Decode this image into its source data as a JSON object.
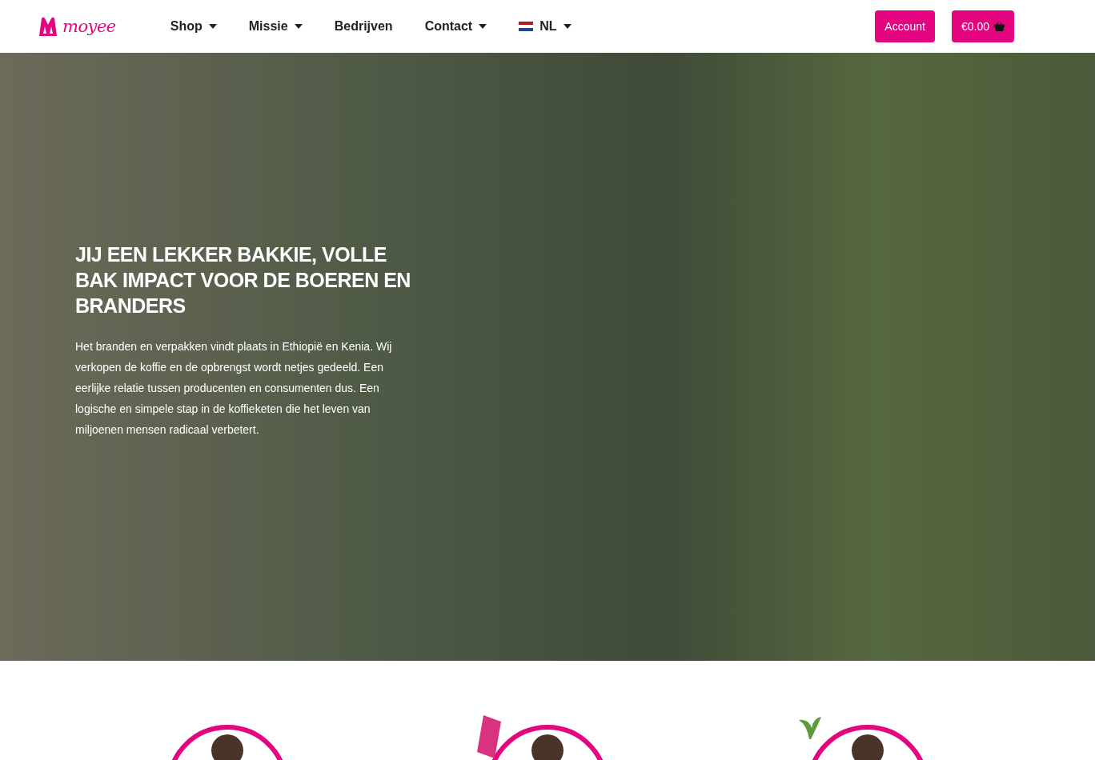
{
  "header": {
    "logo_text": "moyee",
    "nav": [
      {
        "label": "Shop",
        "dropdown": true,
        "kind": "text"
      },
      {
        "label": "Missie",
        "dropdown": true,
        "kind": "text"
      },
      {
        "label": "Bedrijven",
        "dropdown": false,
        "kind": "text"
      },
      {
        "label": "Contact",
        "dropdown": true,
        "kind": "text"
      },
      {
        "label": "NL",
        "dropdown": true,
        "kind": "language"
      }
    ],
    "account_button": "Account",
    "cart_button": "€0.00"
  },
  "hero": {
    "heading": "JIJ EEN LEKKER BAKKIE, VOLLE BAK IMPACT VOOR DE BOEREN EN BRANDERS",
    "text": "Het branden en verpakken vindt plaats in Ethiopië en Kenia. Wij verkopen de koffie en de opbrengst wordt netjes gedeeld. Een eerlijke relatie tussen producenten en consumenten dus. Een logische en simpele stap in de koffieketen die het leven van miljoenen mensen radicaal verbetert."
  },
  "features": [
    {
      "kind": "person"
    },
    {
      "kind": "bag"
    },
    {
      "kind": "plant"
    }
  ]
}
